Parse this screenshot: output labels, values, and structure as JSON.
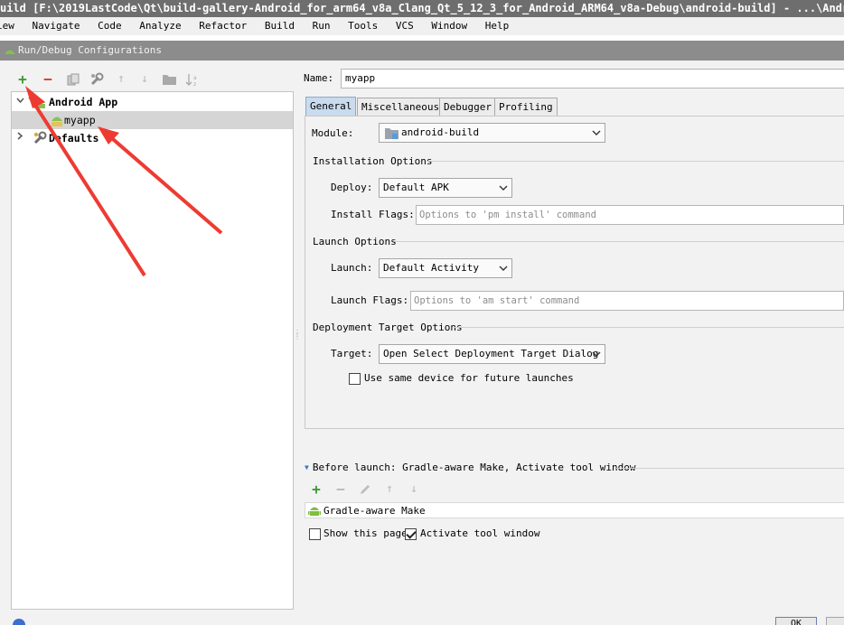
{
  "window": {
    "title": "uild [F:\\2019LastCode\\Qt\\build-gallery-Android_for_arm64_v8a_Clang_Qt_5_12_3_for_Android_ARM64_v8a-Debug\\android-build] - ...\\AndroidM"
  },
  "menu": [
    "iew",
    "Navigate",
    "Code",
    "Analyze",
    "Refactor",
    "Build",
    "Run",
    "Tools",
    "VCS",
    "Window",
    "Help"
  ],
  "dialog": {
    "title": "Run/Debug Configurations"
  },
  "tree": {
    "android_app": "Android App",
    "myapp": "myapp",
    "defaults": "Defaults"
  },
  "form": {
    "name_label": "Name:",
    "name_value": "myapp",
    "tabs": [
      "General",
      "Miscellaneous",
      "Debugger",
      "Profiling"
    ],
    "module_label": "Module:",
    "module_value": "android-build",
    "installation_options": "Installation Options",
    "deploy_label": "Deploy:",
    "deploy_value": "Default APK",
    "install_flags_label": "Install Flags:",
    "install_flags_placeholder": "Options to 'pm install' command",
    "launch_options": "Launch Options",
    "launch_label": "Launch:",
    "launch_value": "Default Activity",
    "launch_flags_label": "Launch Flags:",
    "launch_flags_placeholder": "Options to 'am start' command",
    "deployment_target_options": "Deployment Target Options",
    "target_label": "Target:",
    "target_value": "Open Select Deployment Target Dialog",
    "use_same_device": "Use same device for future launches",
    "use_same_device_checked": false
  },
  "before_launch": {
    "title": "Before launch: Gradle-aware Make, Activate tool window",
    "item": "Gradle-aware Make",
    "show_this_page": "Show this page",
    "show_this_page_checked": false,
    "activate_tool_window": "Activate tool window",
    "activate_tool_window_checked": true
  },
  "buttons": {
    "ok": "OK"
  },
  "colors": {
    "accent_green": "#3d9a38",
    "accent_red": "#d33a2f",
    "annotation_arrow": "#ee3b32",
    "tab_active": "#c9dbee"
  }
}
